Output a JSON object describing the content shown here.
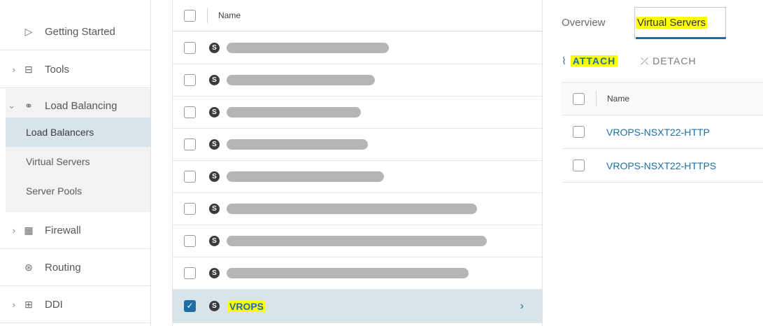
{
  "sidebar": {
    "items": [
      {
        "label": "Getting Started",
        "icon": "play-triangle-icon",
        "expandable": false
      },
      {
        "label": "Tools",
        "icon": "toolbox-icon",
        "expandable": true
      },
      {
        "label": "Load Balancing",
        "icon": "load-balancer-icon",
        "expandable": true,
        "expanded": true
      },
      {
        "label": "Firewall",
        "icon": "firewall-icon",
        "expandable": true
      },
      {
        "label": "Routing",
        "icon": "routing-icon",
        "expandable": false
      },
      {
        "label": "DDI",
        "icon": "ddi-icon",
        "expandable": true
      }
    ],
    "load_balancing_children": [
      {
        "label": "Load Balancers",
        "active": true
      },
      {
        "label": "Virtual Servers",
        "active": false
      },
      {
        "label": "Server Pools",
        "active": false
      }
    ]
  },
  "list": {
    "header": {
      "name": "Name"
    },
    "rows": [
      {
        "redacted": true
      },
      {
        "redacted": true
      },
      {
        "redacted": true
      },
      {
        "redacted": true
      },
      {
        "redacted": true
      },
      {
        "redacted": true
      },
      {
        "redacted": true
      },
      {
        "redacted": true
      },
      {
        "name": "VROPS",
        "checked": true,
        "highlighted": true
      }
    ],
    "status_icon_glyph": "S"
  },
  "details": {
    "tabs": [
      {
        "label": "Overview",
        "active": false
      },
      {
        "label": "Virtual Servers",
        "active": true
      }
    ],
    "actions": {
      "attach": "ATTACH",
      "detach": "DETACH"
    },
    "table": {
      "header": {
        "name": "Name"
      },
      "rows": [
        {
          "name": "VROPS-NSXT22-HTTP"
        },
        {
          "name": "VROPS-NSXT22-HTTPS"
        }
      ]
    }
  },
  "colors": {
    "accent": "#1c6ea4",
    "highlight": "#ffff00",
    "selected_row": "#d9e4ea",
    "redaction": "#b5b5b5"
  }
}
